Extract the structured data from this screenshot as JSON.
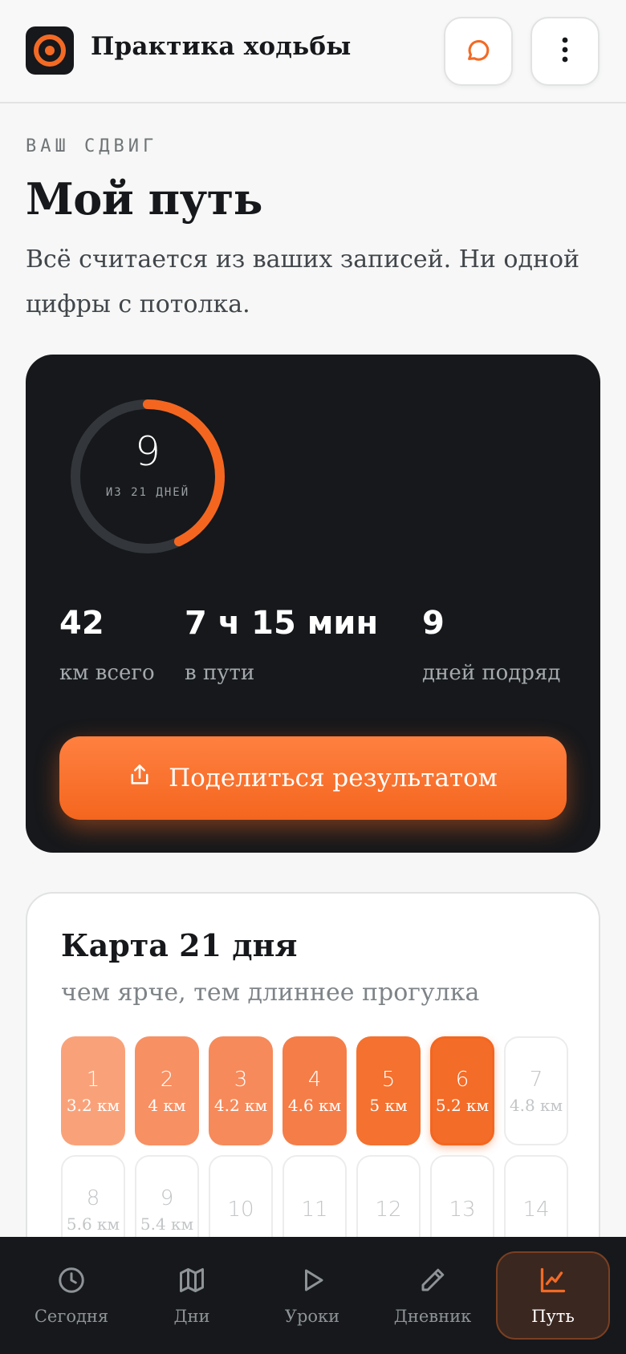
{
  "header": {
    "app_title": "Практика ходьбы",
    "logo_icon": "target-icon",
    "chat_icon": "chat-bubble-icon",
    "menu_icon": "more-vertical-icon",
    "accent": "#f36a25"
  },
  "intro": {
    "eyebrow": "ВАШ СДВИГ",
    "title": "Мой путь",
    "subtitle": "Всё считается из ваших записей. Ни одной цифры с потолка."
  },
  "progress": {
    "current": "9",
    "caption": "ИЗ 21 ДНЕЙ",
    "done_days": 9,
    "total_days": 21
  },
  "stats": [
    {
      "value": "42",
      "label": "км всего"
    },
    {
      "value": "7 ч 15 мин",
      "label": "в пути"
    },
    {
      "value": "9",
      "label": "дней подряд"
    }
  ],
  "share_button": {
    "label": "Поделиться результатом",
    "icon": "share-upload-icon"
  },
  "map": {
    "title": "Карта 21 дня",
    "subtitle": "чем ярче, тем длиннее прогулка",
    "days": [
      {
        "day": "1",
        "km": "3.2 км",
        "color": "#f9a27a",
        "state": "done"
      },
      {
        "day": "2",
        "km": "4 км",
        "color": "#f79063",
        "state": "done"
      },
      {
        "day": "3",
        "km": "4.2 км",
        "color": "#f68a5b",
        "state": "done"
      },
      {
        "day": "4",
        "km": "4.6 км",
        "color": "#f57d48",
        "state": "done"
      },
      {
        "day": "5",
        "km": "5 км",
        "color": "#f4712f",
        "state": "done"
      },
      {
        "day": "6",
        "km": "5.2 км",
        "color": "#f36c28",
        "state": "today"
      },
      {
        "day": "7",
        "km": "4.8 км",
        "color": "#ffffff",
        "state": "future"
      },
      {
        "day": "8",
        "km": "5.6 км",
        "color": "#ffffff",
        "state": "future"
      },
      {
        "day": "9",
        "km": "5.4 км",
        "color": "#ffffff",
        "state": "future"
      },
      {
        "day": "10",
        "km": "",
        "color": "#ffffff",
        "state": "future"
      },
      {
        "day": "11",
        "km": "",
        "color": "#ffffff",
        "state": "future"
      },
      {
        "day": "12",
        "km": "",
        "color": "#ffffff",
        "state": "future"
      },
      {
        "day": "13",
        "km": "",
        "color": "#ffffff",
        "state": "future"
      },
      {
        "day": "14",
        "km": "",
        "color": "#ffffff",
        "state": "future"
      }
    ]
  },
  "nav": [
    {
      "label": "Сегодня",
      "icon": "clock-icon",
      "active": false
    },
    {
      "label": "Дни",
      "icon": "map-icon",
      "active": false
    },
    {
      "label": "Уроки",
      "icon": "play-icon",
      "active": false
    },
    {
      "label": "Дневник",
      "icon": "pencil-icon",
      "active": false
    },
    {
      "label": "Путь",
      "icon": "chart-line-icon",
      "active": true
    }
  ]
}
